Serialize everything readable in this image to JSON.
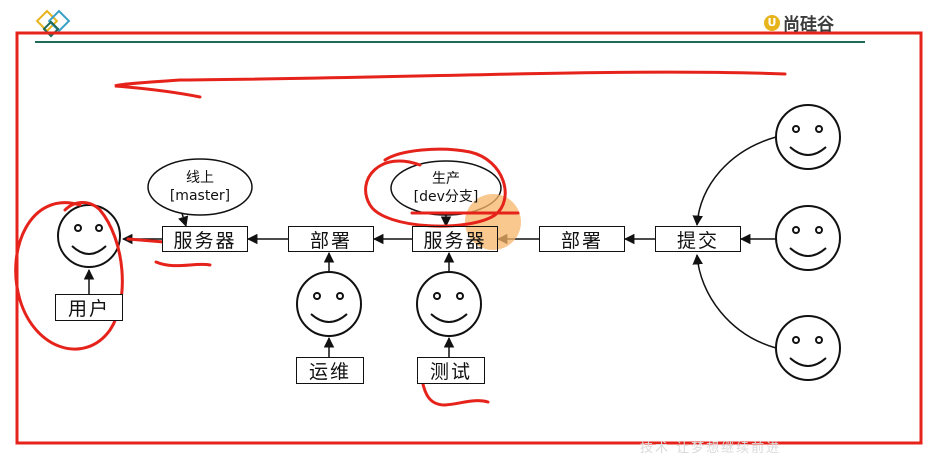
{
  "header": {
    "brand_mark": "U",
    "brand_name": "尚硅谷"
  },
  "diagram": {
    "user_box": "用户",
    "server_left": "服务器",
    "bubble_left_line1": "线上",
    "bubble_left_line2": "[master]",
    "deploy_left": "部署",
    "server_mid": "服务器",
    "bubble_mid_line1": "生产",
    "bubble_mid_line2": "[dev分支]",
    "deploy_right": "部署",
    "commit": "提交",
    "ops": "运维",
    "test": "测试"
  },
  "footer": {
    "watermark": "技术 让梦想继续前进"
  },
  "colors": {
    "annotation_red": "#e5231b",
    "highlight_orange": "#f5b66a",
    "header_line": "#1f6b5a",
    "brand_yellow": "#e8b41c"
  },
  "icons": [
    "diamond-logo-icon",
    "smiley-face-icon"
  ]
}
